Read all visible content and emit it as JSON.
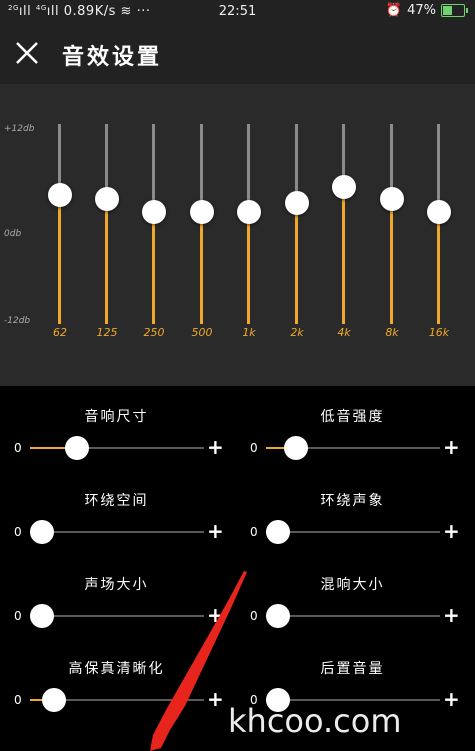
{
  "status_bar": {
    "signal1": "2G",
    "signal2": "4G",
    "speed": "0.89K/s",
    "time": "22:51",
    "battery_percent": "47%",
    "battery_level": 0.47
  },
  "header": {
    "title": "音效设置",
    "close_icon": "close-icon"
  },
  "equalizer": {
    "db_labels": [
      "+12db",
      "0db",
      "-12db"
    ],
    "range_db": [
      -12,
      12
    ],
    "bands": [
      {
        "freq": "62",
        "gain_db": 3.5
      },
      {
        "freq": "125",
        "gain_db": 3.0
      },
      {
        "freq": "250",
        "gain_db": 1.5
      },
      {
        "freq": "500",
        "gain_db": 1.5
      },
      {
        "freq": "1k",
        "gain_db": 1.5
      },
      {
        "freq": "2k",
        "gain_db": 2.5
      },
      {
        "freq": "4k",
        "gain_db": 4.5
      },
      {
        "freq": "8k",
        "gain_db": 3.0
      },
      {
        "freq": "16k",
        "gain_db": 1.5
      }
    ]
  },
  "effects": [
    {
      "label": "音响尺寸",
      "min_label": "0",
      "max_icon": "plus-icon",
      "level": 0.27
    },
    {
      "label": "低音强度",
      "min_label": "0",
      "max_icon": "plus-icon",
      "level": 0.17
    },
    {
      "label": "环绕空间",
      "min_label": "0",
      "max_icon": "plus-icon",
      "level": 0.0
    },
    {
      "label": "环绕声象",
      "min_label": "0",
      "max_icon": "plus-icon",
      "level": 0.0
    },
    {
      "label": "声场大小",
      "min_label": "0",
      "max_icon": "plus-icon",
      "level": 0.0
    },
    {
      "label": "混响大小",
      "min_label": "0",
      "max_icon": "plus-icon",
      "level": 0.0
    },
    {
      "label": "高保真清晰化",
      "min_label": "0",
      "max_icon": "plus-icon",
      "level": 0.14
    },
    {
      "label": "后置音量",
      "min_label": "0",
      "max_icon": "plus-icon",
      "level": 0.0
    }
  ],
  "watermark": "khcoo.com",
  "colors": {
    "accent": "#f0a82a",
    "annotation_arrow": "#e8251c"
  }
}
